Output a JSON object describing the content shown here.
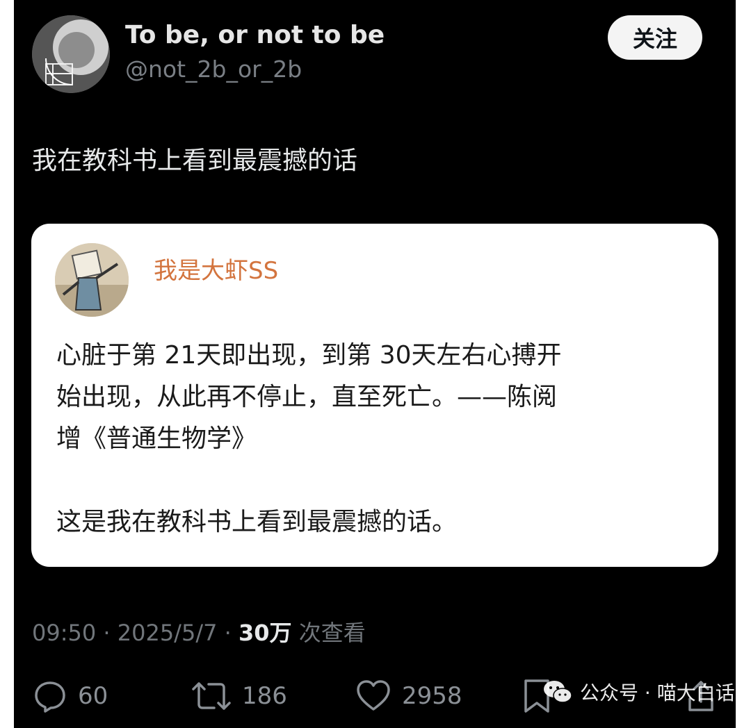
{
  "author": {
    "name": "To be, or not to be",
    "handle": "@not_2b_or_2b"
  },
  "follow_label": "关注",
  "tweet": {
    "text": "我在教科书上看到最震撼的话"
  },
  "quoted": {
    "author": "我是大虾SS",
    "body_line1": "心脏于第 21天即出现，到第 30天左右心搏开",
    "body_line2": "始出现，从此再不停止，直至死亡。——陈阅",
    "body_line3": "增《普通生物学》",
    "body_line4": "这是我在教科书上看到最震撼的话。"
  },
  "meta": {
    "time": "09:50",
    "date": "2025/5/7",
    "views_count": "30万",
    "views_label": "次查看"
  },
  "actions": {
    "replies": "60",
    "reposts": "186",
    "likes": "2958"
  },
  "watermark": {
    "text": "公众号 · 喵大白话"
  },
  "icons": [
    "reply-icon",
    "repost-icon",
    "like-icon",
    "bookmark-icon",
    "share-icon",
    "wechat-icon"
  ]
}
